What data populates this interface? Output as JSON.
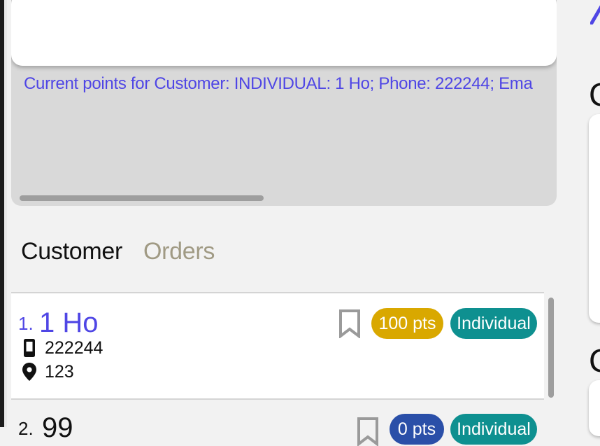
{
  "points": {
    "text": "Current points for Customer: INDIVIDUAL: 1 Ho; Phone: 222244; Ema"
  },
  "tabs": [
    {
      "label": "Customer",
      "active": true
    },
    {
      "label": "Orders",
      "active": false
    }
  ],
  "customers": [
    {
      "index": "1.",
      "name": "1 Ho",
      "phone": "222244",
      "address": "123",
      "points": "100 pts",
      "points_color": "#d9a800",
      "type": "Individual",
      "type_color": "#0e9090"
    },
    {
      "index": "2.",
      "name": "99",
      "points": "0 pts",
      "points_color": "#2a4fa8",
      "type": "Individual",
      "type_color": "#0e9090"
    }
  ],
  "right_column": {
    "letter1": "C",
    "letter2": "C"
  },
  "icons": {
    "phone": "phone-icon",
    "location": "location-pin-icon",
    "bookmark": "bookmark-icon"
  },
  "colors": {
    "accent": "#4f46e5",
    "background": "#f2f2f2"
  }
}
